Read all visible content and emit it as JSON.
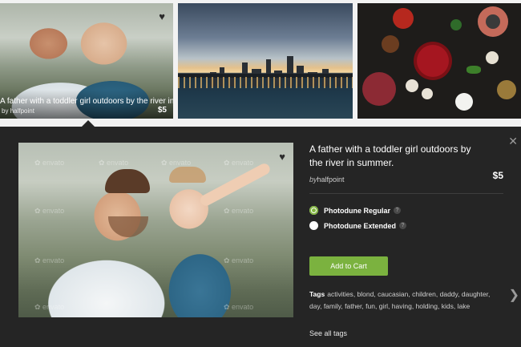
{
  "thumbnails": [
    {
      "title": "A father with a toddler girl outdoors by the river in s...",
      "by_prefix": "by",
      "author": "halfpoint",
      "price": "$5",
      "heart_icon": "heart-icon"
    },
    {
      "subject": "city-skyline"
    },
    {
      "subject": "food-ingredients"
    }
  ],
  "detail": {
    "title": "A father with a toddler girl outdoors by the river in summer.",
    "by_prefix": "by",
    "author": "halfpoint",
    "price": "$5",
    "watermark": "envato",
    "licenses": [
      {
        "label": "Photodune Regular",
        "selected": true
      },
      {
        "label": "Photodune Extended",
        "selected": false
      }
    ],
    "add_to_cart": "Add to Cart",
    "tags_label": "Tags",
    "tags": [
      "activities",
      "blond",
      "caucasian",
      "children",
      "daddy",
      "daughter",
      "day",
      "family",
      "father",
      "fun",
      "girl",
      "having",
      "holding",
      "kids",
      "lake"
    ],
    "see_all": "See all tags",
    "close_icon": "close-icon",
    "next_icon": "chevron-right-icon"
  },
  "colors": {
    "panel_bg": "#252525",
    "accent_green": "#7bb23f",
    "page_bg": "#f2f2f2"
  }
}
